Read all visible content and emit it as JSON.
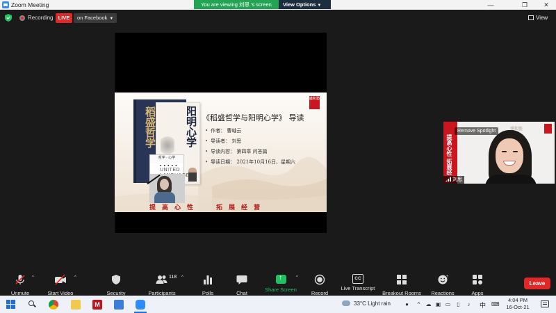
{
  "window": {
    "title": "Zoom Meeting"
  },
  "share_banner": {
    "viewing_text": "You are viewing 刘思 's screen",
    "view_options": "View Options"
  },
  "status": {
    "recording_label": "Recording",
    "live_label": "LIVE",
    "live_destination": "on Facebook",
    "view_label": "View"
  },
  "slide": {
    "heading": "《稻盛哲学与阳明心学》 导读",
    "bullets": [
      "作者： 曹岫云",
      "导读者： 刘思",
      "导读内容： 第四章 问答篇",
      "导读日期： 2021年10月16日、星期六"
    ],
    "book_title_main": "稻盛哲学",
    "book_title_side": "阳明心学",
    "book_author": "曹岫云 著",
    "footer_left": "提高心性",
    "footer_right": "拓展经营",
    "logo_text": "盛和塾",
    "overlay_top": "哲学 · 心学",
    "overlay_watermark": "UNITED LANGUAGE CENTRE"
  },
  "participant": {
    "name": "刘思",
    "remove_spotlight": "Remove Spotlight",
    "banner_text": "提高心性 拓展经",
    "wall_text": "盛和塾"
  },
  "toolbar": {
    "unmute": "Unmute",
    "start_video": "Start Video",
    "security": "Security",
    "participants": "Participants",
    "participants_count": "118",
    "polls": "Polls",
    "chat": "Chat",
    "share_screen": "Share Screen",
    "record": "Record",
    "live_transcript": "Live Transcript",
    "breakout_rooms": "Breakout Rooms",
    "reactions": "Reactions",
    "apps": "Apps",
    "leave": "Leave",
    "cc_icon_text": "CC"
  },
  "taskbar": {
    "weather": "33°C  Light rain",
    "ime": "中",
    "time": "4:04 PM",
    "date": "16-Oct-21"
  },
  "colors": {
    "zoom_blue": "#2d8cff",
    "share_green": "#23a454",
    "live_red": "#e02828",
    "slide_red": "#c9161f"
  }
}
